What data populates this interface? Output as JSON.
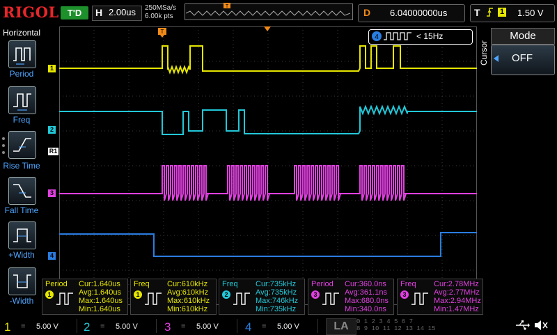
{
  "header": {
    "logo": "RIGOL",
    "status": "T'D",
    "horizontal_label": "H",
    "timebase": "2.00us",
    "sample_rate": "250MSa/s",
    "memory_depth": "6.00k pts",
    "delay_label": "D",
    "delay_value": "6.04000000us",
    "trigger_label": "T",
    "trigger_source": "1",
    "trigger_level": "1.50 V"
  },
  "left_menu": {
    "title": "Horizontal",
    "items": [
      "Period",
      "Freq",
      "Rise Time",
      "Fall Time",
      "+Width",
      "-Width"
    ]
  },
  "right_menu": {
    "title": "Mode",
    "side_label": "Cursor",
    "value": "OFF"
  },
  "counter": {
    "channel": "4",
    "value": "< 15Hz"
  },
  "markers": {
    "ch1": "1",
    "ch2": "2",
    "ch3": "3",
    "ch4": "4",
    "ref": "R1",
    "trig": "T"
  },
  "measurements": [
    {
      "name": "Period",
      "src": "1",
      "color": "#e6e600",
      "cur": "Cur:1.640us",
      "avg": "Avg:1.640us",
      "max": "Max:1.640us",
      "min": "Min:1.640us"
    },
    {
      "name": "Freq",
      "src": "1",
      "color": "#e6e600",
      "cur": "Cur:610kHz",
      "avg": "Avg:610kHz",
      "max": "Max:610kHz",
      "min": "Min:610kHz"
    },
    {
      "name": "Freq",
      "src": "2",
      "color": "#22c8d8",
      "cur": "Cur:735kHz",
      "avg": "Avg:735kHz",
      "max": "Max:746kHz",
      "min": "Min:735kHz"
    },
    {
      "name": "Period",
      "src": "3",
      "color": "#e040e0",
      "cur": "Cur:360.0ns",
      "avg": "Avg:361.1ns",
      "max": "Max:680.0ns",
      "min": "Min:340.0ns"
    },
    {
      "name": "Freq",
      "src": "3",
      "color": "#e040e0",
      "cur": "Cur:2.78MHz",
      "avg": "Avg:2.77MHz",
      "max": "Max:2.94MHz",
      "min": "Min:1.47MHz"
    }
  ],
  "channels": [
    {
      "num": "1",
      "scale": "5.00 V",
      "color": "#e6e600"
    },
    {
      "num": "2",
      "scale": "5.00 V",
      "color": "#22c8d8"
    },
    {
      "num": "3",
      "scale": "5.00 V",
      "color": "#e040e0"
    },
    {
      "num": "4",
      "scale": "5.00 V",
      "color": "#2a7de0"
    }
  ],
  "la": {
    "label": "LA",
    "row1": "0 1 2 3  4 5 6 7",
    "row2": "8 9 10 11 12 13 14 15"
  },
  "icons": [
    "usb-icon",
    "mute-icon"
  ]
}
